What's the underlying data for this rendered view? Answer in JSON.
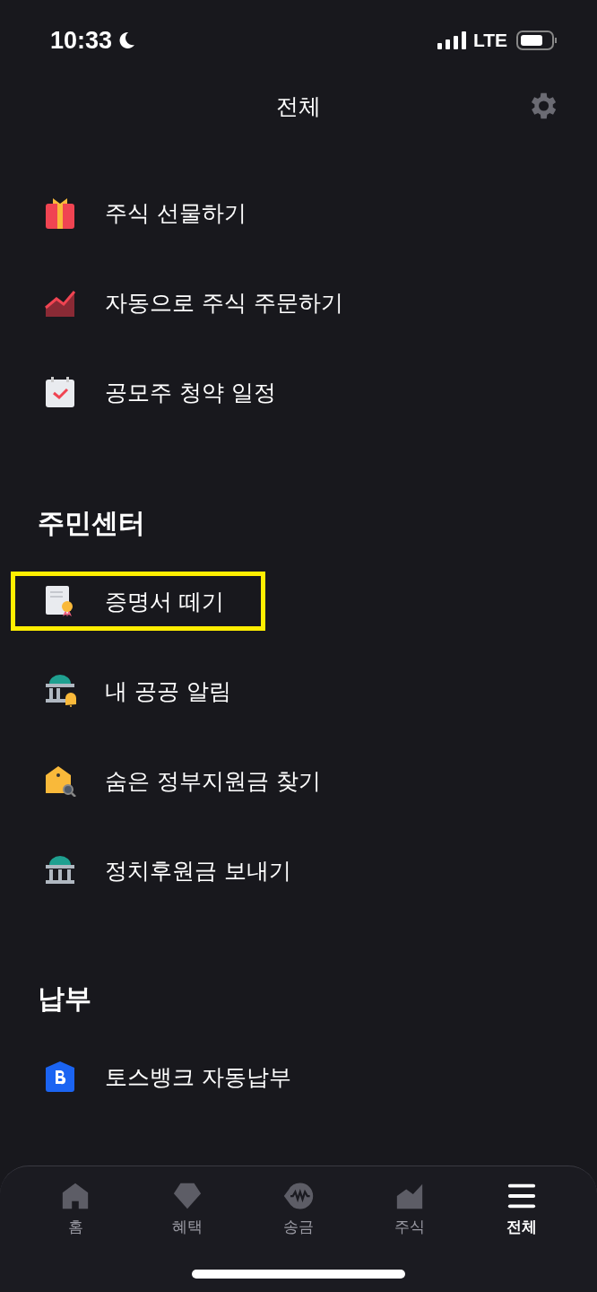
{
  "status_bar": {
    "time": "10:33",
    "network": "LTE"
  },
  "header": {
    "title": "전체"
  },
  "sections": [
    {
      "items": [
        {
          "label": "주식 선물하기",
          "kind": "gift",
          "highlighted": false
        },
        {
          "label": "자동으로 주식 주문하기",
          "kind": "chart",
          "highlighted": false
        },
        {
          "label": "공모주 청약 일정",
          "kind": "calendar",
          "highlighted": false
        }
      ]
    },
    {
      "title": "주민센터",
      "items": [
        {
          "label": "증명서 떼기",
          "kind": "certificate",
          "highlighted": true
        },
        {
          "label": "내 공공 알림",
          "kind": "bell-building",
          "highlighted": false
        },
        {
          "label": "숨은 정부지원금 찾기",
          "kind": "search-house",
          "highlighted": false
        },
        {
          "label": "정치후원금 보내기",
          "kind": "building",
          "highlighted": false
        }
      ]
    },
    {
      "title": "납부",
      "items": [
        {
          "label": "토스뱅크 자동납부",
          "kind": "bank",
          "highlighted": false
        }
      ]
    }
  ],
  "tab_bar": [
    {
      "label": "홈",
      "kind": "home",
      "selected": false
    },
    {
      "label": "혜택",
      "kind": "gem",
      "selected": false
    },
    {
      "label": "송금",
      "kind": "won",
      "selected": false
    },
    {
      "label": "주식",
      "kind": "stock",
      "selected": false
    },
    {
      "label": "전체",
      "kind": "menu",
      "selected": true
    }
  ]
}
